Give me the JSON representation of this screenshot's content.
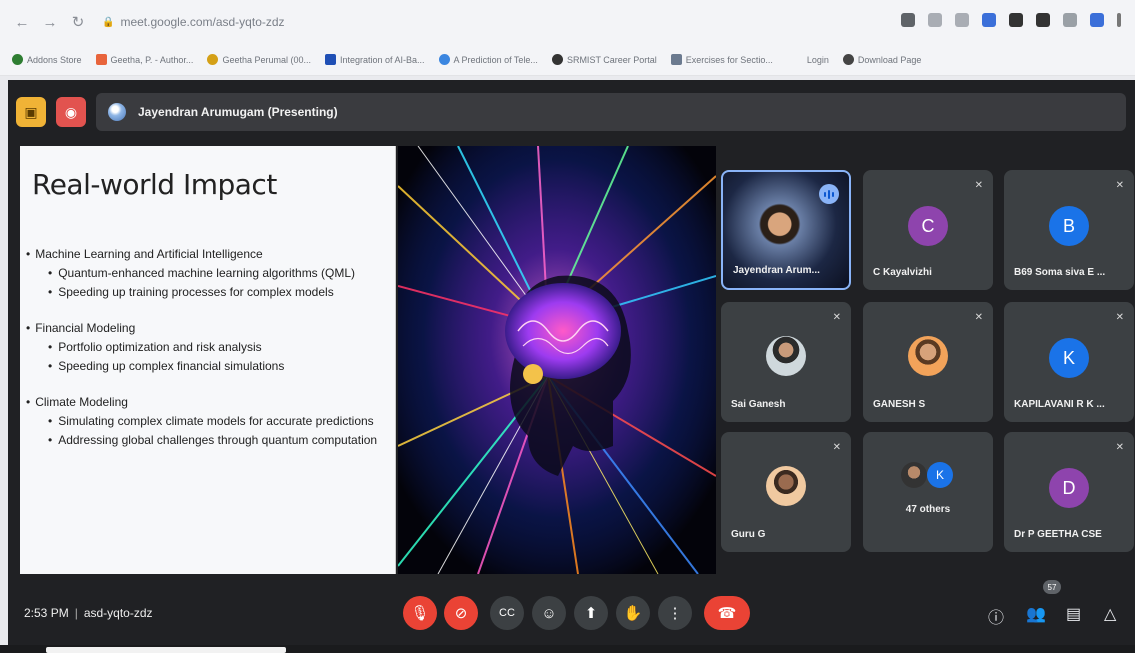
{
  "browser": {
    "url": "meet.google.com/asd-yqto-zdz",
    "bookmarks": [
      {
        "label": "Addons Store",
        "color": "#2e7d32",
        "shape": "round"
      },
      {
        "label": "Geetha, P. - Author...",
        "color": "#e8643c",
        "shape": "square"
      },
      {
        "label": "Geetha Perumal (00...",
        "color": "#d4a017",
        "shape": "round"
      },
      {
        "label": "Integration of AI-Ba...",
        "color": "#1f4fb5",
        "shape": "square"
      },
      {
        "label": "A Prediction of Tele...",
        "color": "#3b86e0",
        "shape": "round"
      },
      {
        "label": "SRMIST Career Portal",
        "color": "#333333",
        "shape": "round"
      },
      {
        "label": "Exercises for Sectio...",
        "color": "#6b7a8f",
        "shape": "square"
      },
      {
        "label": "Login",
        "color": "",
        "shape": "none"
      },
      {
        "label": "Download Page",
        "color": "#444444",
        "shape": "round"
      }
    ]
  },
  "meet": {
    "presenting_label": "Jayendran Arumugam (Presenting)",
    "meeting_code": "asd-yqto-zdz",
    "time": "2:53 PM",
    "participant_count": "57",
    "accent_red": "#ea4335",
    "tile_bg": "#3c4043"
  },
  "slide": {
    "title": "Real-world Impact",
    "sections": [
      {
        "heading": "Machine Learning and Artificial Intelligence",
        "items": [
          "Quantum-enhanced machine learning algorithms (QML)",
          "Speeding up training processes for complex models"
        ]
      },
      {
        "heading": "Financial Modeling",
        "items": [
          "Portfolio optimization and risk analysis",
          "Speeding up complex financial simulations"
        ]
      },
      {
        "heading": "Climate Modeling",
        "items": [
          "Simulating complex climate models for accurate predictions",
          "Addressing global challenges through quantum computation"
        ]
      }
    ]
  },
  "participants": [
    {
      "name": "Jayendran Arum...",
      "type": "video",
      "speaking": true
    },
    {
      "name": "C Kayalvizhi",
      "type": "letter",
      "letter": "C",
      "color": "#8e44ad"
    },
    {
      "name": "B69 Soma siva E ...",
      "type": "letter",
      "letter": "B",
      "color": "#1a73e8"
    },
    {
      "name": "Sai Ganesh",
      "type": "photo"
    },
    {
      "name": "GANESH S",
      "type": "photo"
    },
    {
      "name": "KAPILAVANI R K ...",
      "type": "letter",
      "letter": "K",
      "color": "#1a73e8"
    },
    {
      "name": "Guru G",
      "type": "photo"
    },
    {
      "name": "47 others",
      "type": "others",
      "letter": "K",
      "color": "#1a73e8"
    },
    {
      "name": "Dr P GEETHA CSE",
      "type": "letter",
      "letter": "D",
      "color": "#8e44ad"
    }
  ]
}
